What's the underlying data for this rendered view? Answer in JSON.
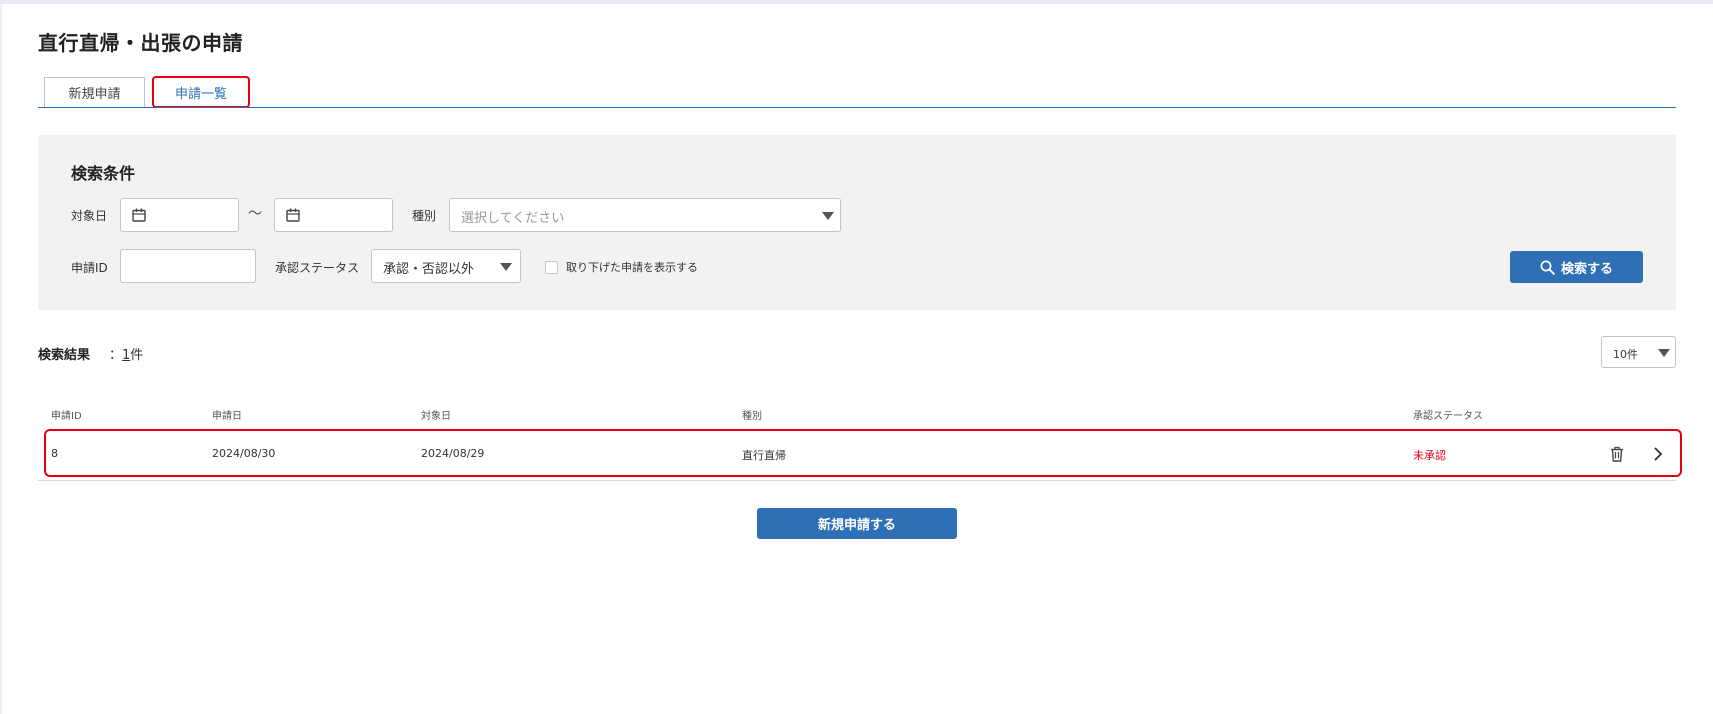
{
  "page": {
    "title": "直行直帰・出張の申請"
  },
  "tabs": [
    {
      "label": "新規申請"
    },
    {
      "label": "申請一覧"
    }
  ],
  "search": {
    "title": "検索条件",
    "date_label": "対象日",
    "range_sep": "～",
    "type_label": "種別",
    "type_placeholder": "選択してください",
    "id_label": "申請ID",
    "id_value": "",
    "status_label": "承認ステータス",
    "status_value": "承認・否認以外",
    "show_withdrawn_label": "取り下げた申請を表示する",
    "show_withdrawn_checked": false,
    "button_label": "検索する"
  },
  "results": {
    "label": "検索結果",
    "count_prefix": "：",
    "count": "1",
    "count_unit": "件",
    "page_size": "10件"
  },
  "table": {
    "headers": [
      "申請ID",
      "申請日",
      "対象日",
      "種別",
      "承認ステータス"
    ],
    "rows": [
      {
        "id": "8",
        "applied": "2024/08/30",
        "target": "2024/08/29",
        "type": "直行直帰",
        "status": "未承認"
      }
    ]
  },
  "new_button": {
    "label": "新規申請する"
  },
  "colors": {
    "accent": "#2e6fb5",
    "highlight": "#e60012",
    "panel": "#f2f2f2"
  }
}
